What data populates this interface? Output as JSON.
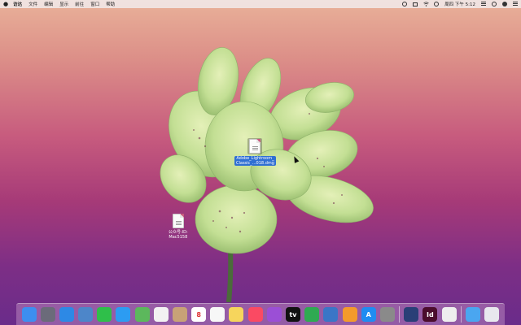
{
  "menubar": {
    "app_name": "访达",
    "menus": [
      "文件",
      "编辑",
      "显示",
      "前往",
      "窗口",
      "帮助"
    ],
    "clock": "周四 下午 5:12",
    "status_icons": [
      "record-icon",
      "screen-icon",
      "wifi-icon",
      "clock-icon",
      "list-icon",
      "search-icon",
      "user-icon",
      "notification-icon"
    ]
  },
  "desktop": {
    "files": [
      {
        "name_line1": "Adobe_Lightroom_",
        "name_line2": "Classic_...018.dmg",
        "selected": true
      },
      {
        "name_line1": "公众号:ID:",
        "name_line2": "Mac5158",
        "selected": false
      }
    ]
  },
  "dock": {
    "apps": [
      {
        "name": "finder-icon",
        "color": "#3d8ef0"
      },
      {
        "name": "launchpad-icon",
        "color": "#6b6b7a"
      },
      {
        "name": "safari-icon",
        "color": "#2d89e5"
      },
      {
        "name": "preview-icon",
        "color": "#4d86c9"
      },
      {
        "name": "facetime-icon",
        "color": "#2fbf4a"
      },
      {
        "name": "messages-icon",
        "color": "#2c9cf2"
      },
      {
        "name": "maps-icon",
        "color": "#5cb85c"
      },
      {
        "name": "photos-icon",
        "color": "#f2f2f2"
      },
      {
        "name": "contacts-icon",
        "color": "#c8a277"
      },
      {
        "name": "calendar-icon",
        "color": "#ffffff",
        "text": "8"
      },
      {
        "name": "reminders-icon",
        "color": "#f7f7f7"
      },
      {
        "name": "notes-icon",
        "color": "#f6d55c"
      },
      {
        "name": "music-icon",
        "color": "#fa4a63"
      },
      {
        "name": "podcasts-icon",
        "color": "#9b4fd6"
      },
      {
        "name": "appletv-icon",
        "color": "#111111",
        "text": "tv"
      },
      {
        "name": "numbers-icon",
        "color": "#2faa52"
      },
      {
        "name": "keynote-icon",
        "color": "#3a76c7"
      },
      {
        "name": "pages-icon",
        "color": "#f39a2c"
      },
      {
        "name": "appstore-icon",
        "color": "#1f8cf2",
        "text": "A"
      },
      {
        "name": "system-preferences-icon",
        "color": "#8a8a8a"
      },
      {
        "name": "quicktime-icon",
        "color": "#2a3f77"
      },
      {
        "name": "indesign-icon",
        "color": "#4b0d2d",
        "text": "Id"
      },
      {
        "name": "textedit-icon",
        "color": "#eeeeee"
      },
      {
        "name": "downloads-folder-icon",
        "color": "#4aa6f0"
      },
      {
        "name": "trash-icon",
        "color": "#e8e8ee"
      }
    ]
  }
}
